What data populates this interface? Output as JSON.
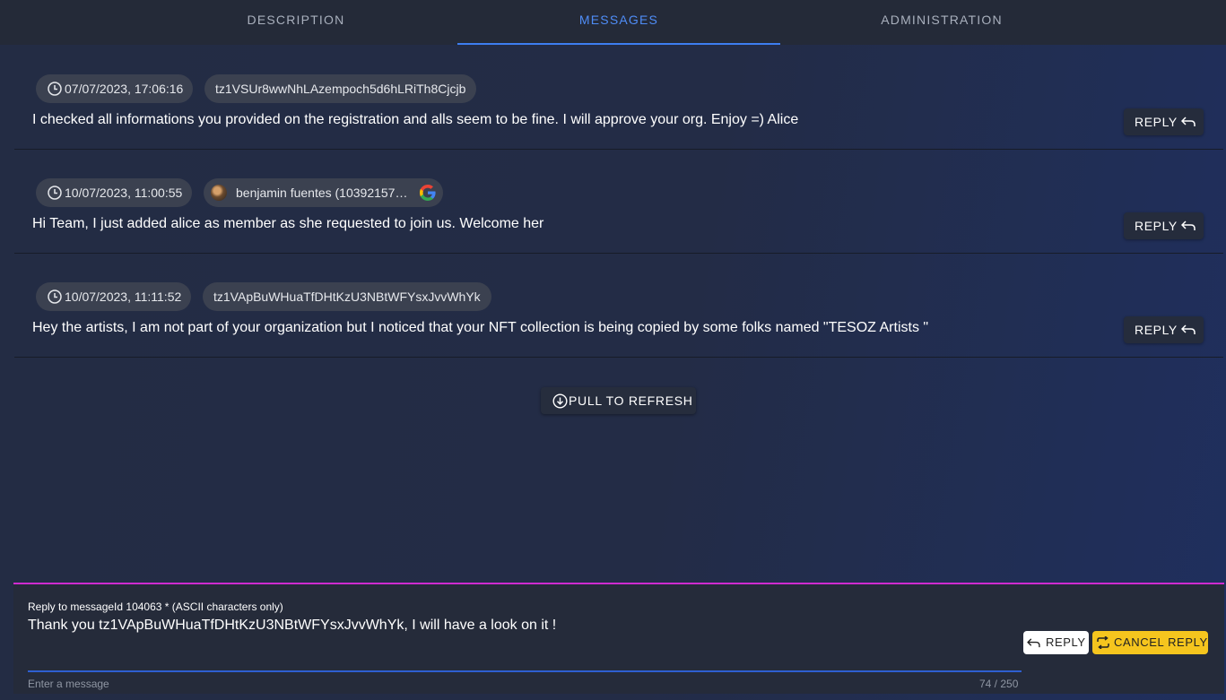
{
  "tabs": [
    {
      "label": "DESCRIPTION"
    },
    {
      "label": "MESSAGES"
    },
    {
      "label": "ADMINISTRATION"
    }
  ],
  "active_tab": "MESSAGES",
  "messages": [
    {
      "date": "07/07/2023, 17:06:16",
      "author": "tz1VSUr8wwNhLAzempoch5d6hLRiTh8Cjcjb",
      "text": "I checked all informations you provided on the registration and alls seem to be fine. I will approve your org. Enjoy =)  Alice",
      "reply_label": "REPLY"
    },
    {
      "date": "10/07/2023, 11:00:55",
      "author": "benjamin fuentes (10392157…",
      "author_icon": "google-icon",
      "text": "Hi Team, I just added alice as member as she requested to join us. Welcome her",
      "reply_label": "REPLY"
    },
    {
      "date": "10/07/2023, 11:11:52",
      "author": "tz1VApBuWHuaTfDHtKzU3NBtWFYsxJvvWhYk",
      "text": "Hey the artists, I am not part of your organization but I noticed that your NFT collection is being copied by some folks named \"TESOZ Artists \"",
      "reply_label": "REPLY"
    }
  ],
  "refresh_label": "PULL TO REFRESH",
  "composer": {
    "label": "Reply to messageId 104063 * (ASCII characters only)",
    "value": "Thank you tz1VApBuWHuaTfDHtKzU3NBtWFYsxJvvWhYk, I will have a look on it !",
    "placeholder": "Enter a message",
    "counter": "74 / 250",
    "send_label": "REPLY",
    "cancel_label": "CANCEL REPLY"
  },
  "colors": {
    "accent": "#3d7ef0",
    "composer_border": "#cf2bd0",
    "cancel_button": "#f5c51e"
  }
}
